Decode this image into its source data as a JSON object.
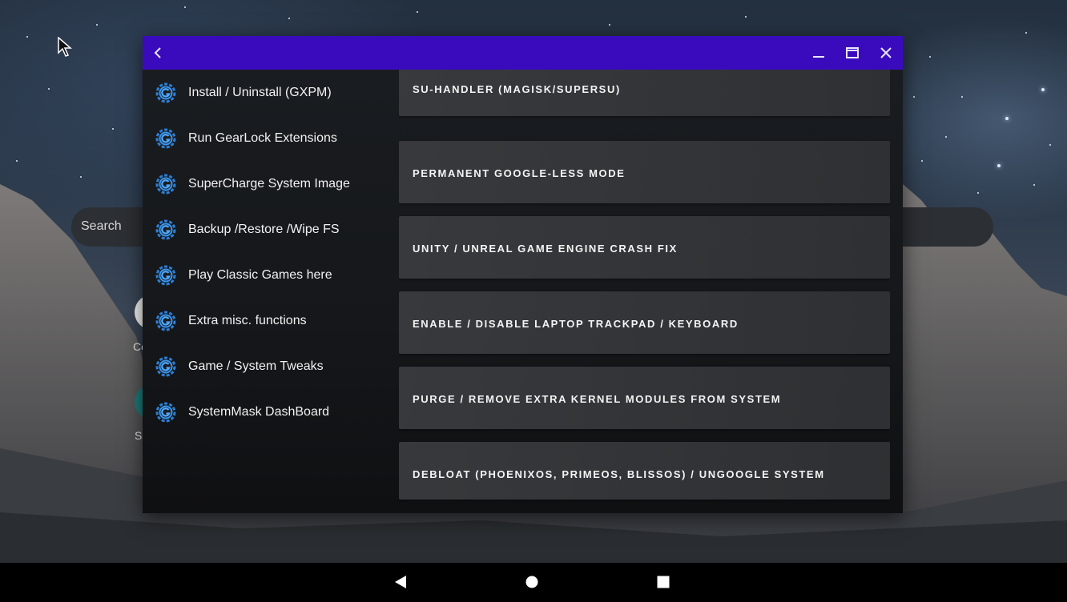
{
  "desktop": {
    "search_placeholder": "Search",
    "partial_label_1": "Co",
    "partial_label_2": "S"
  },
  "window": {
    "titlebar_color": "#3a0bbd",
    "back_icon": "chevron-left-icon",
    "minimize_icon": "minimize-icon",
    "maximize_icon": "maximize-icon",
    "close_icon": "close-icon"
  },
  "sidebar": {
    "items": [
      {
        "label": "Install / Uninstall (GXPM)",
        "icon": "gearlock-icon"
      },
      {
        "label": "Run GearLock Extensions",
        "icon": "gearlock-icon"
      },
      {
        "label": "SuperCharge System Image",
        "icon": "gearlock-icon"
      },
      {
        "label": "Backup /Restore /Wipe FS",
        "icon": "gearlock-icon"
      },
      {
        "label": "Play Classic Games here",
        "icon": "gearlock-icon"
      },
      {
        "label": "Extra misc. functions",
        "icon": "gearlock-icon"
      },
      {
        "label": "Game / System Tweaks",
        "icon": "gearlock-icon"
      },
      {
        "label": "SystemMask DashBoard",
        "icon": "gearlock-icon"
      }
    ]
  },
  "content": {
    "cards": [
      {
        "label": "SU-HANDLER (MAGISK/SUPERSU)"
      },
      {
        "label": "PERMANENT GOOGLE-LESS MODE"
      },
      {
        "label": "UNITY / UNREAL GAME ENGINE CRASH FIX"
      },
      {
        "label": "ENABLE / DISABLE LAPTOP TRACKPAD / KEYBOARD"
      },
      {
        "label": "PURGE / REMOVE EXTRA KERNEL MODULES FROM SYSTEM"
      },
      {
        "label": "DEBLOAT (PHOENIXOS, PRIMEOS, BLISSOS) / UNGOOGLE SYSTEM"
      }
    ]
  },
  "navbar": {
    "back_icon": "nav-back-icon",
    "home_icon": "nav-home-icon",
    "recents_icon": "nav-recents-icon"
  }
}
